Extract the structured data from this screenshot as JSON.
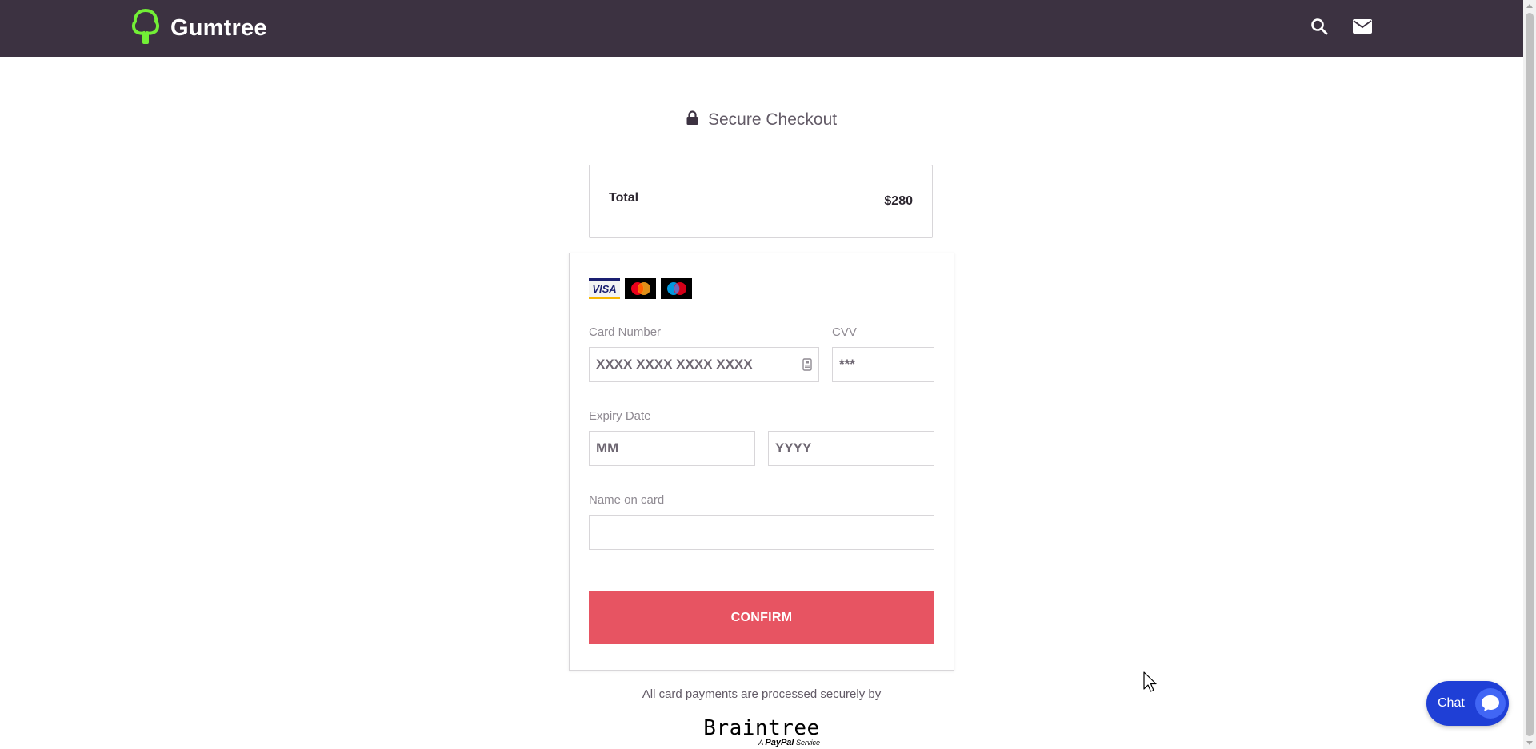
{
  "header": {
    "brand": "Gumtree",
    "brand_color": "#72ef36",
    "background_color": "#3c3241",
    "icons": [
      "search-icon",
      "mail-icon"
    ]
  },
  "checkout": {
    "heading": "Secure Checkout",
    "heading_icon": "lock-icon",
    "total_label": "Total",
    "total_value": "$280"
  },
  "payment_form": {
    "accepted_cards": [
      "VISA",
      "Mastercard",
      "Maestro"
    ],
    "card_number": {
      "label": "Card Number",
      "placeholder": "XXXX XXXX XXXX XXXX",
      "value": ""
    },
    "cvv": {
      "label": "CVV",
      "placeholder": "***",
      "value": ""
    },
    "expiry": {
      "label": "Expiry Date",
      "month_placeholder": "MM",
      "year_placeholder": "YYYY"
    },
    "name_on_card": {
      "label": "Name on card",
      "value": ""
    },
    "confirm_label": "CONFIRM",
    "confirm_color": "#e75462"
  },
  "footer": {
    "processed_text": "All card payments are processed securely by",
    "processor": "Braintree",
    "processor_sub_prefix": "A",
    "processor_sub_brand": "PayPal",
    "processor_sub_suffix": "Service"
  },
  "chat": {
    "label": "Chat",
    "color": "#1f3fd6"
  }
}
